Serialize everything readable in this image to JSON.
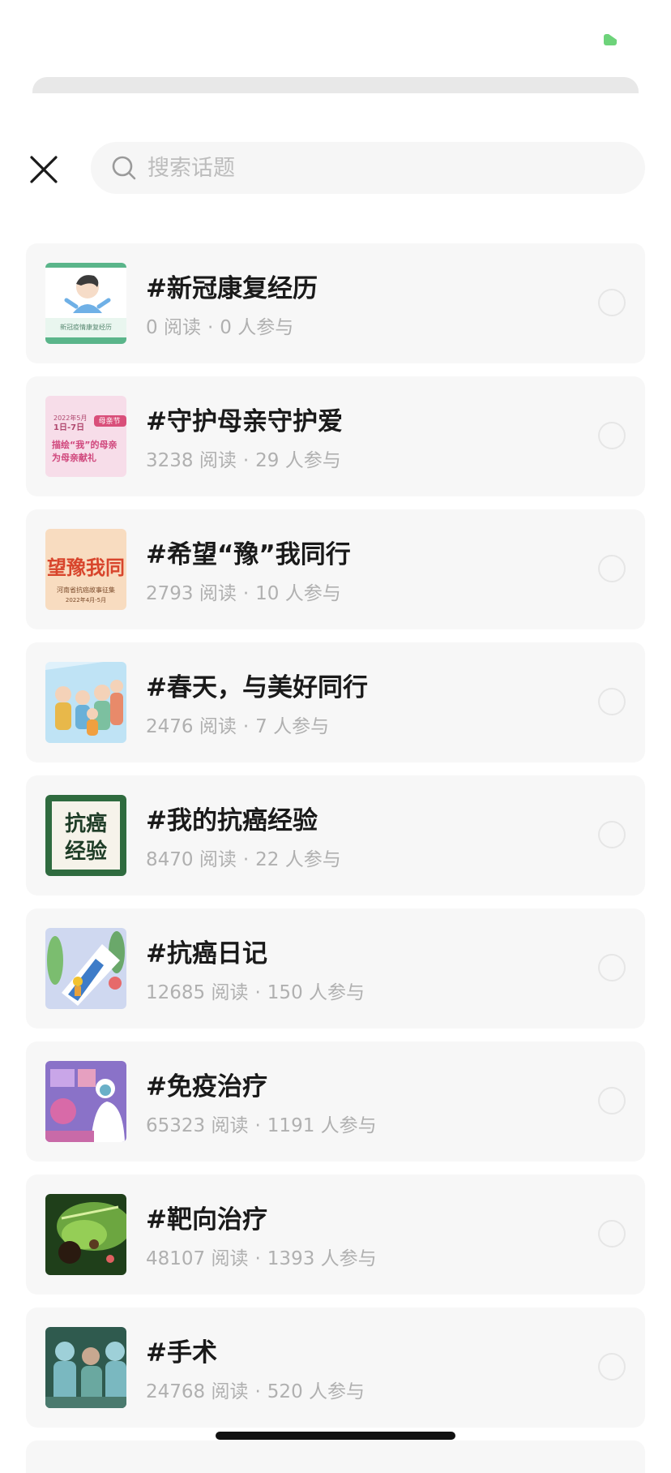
{
  "search": {
    "placeholder": "搜索话题"
  },
  "icons": {
    "close": "close-icon",
    "search": "search-icon",
    "status": "status-icon"
  },
  "colors": {
    "status_green": "#6dd37a",
    "card_bg": "#f7f7f7",
    "stats_gray": "#b0b0b0"
  },
  "topics": [
    {
      "title": "#新冠康复经历",
      "reads": "0 阅读",
      "participants": "0 人参与"
    },
    {
      "title": "#守护母亲守护爱",
      "reads": "3238 阅读",
      "participants": "29 人参与"
    },
    {
      "title": "#希望“豫”我同行",
      "reads": "2793 阅读",
      "participants": "10 人参与"
    },
    {
      "title": "#春天，与美好同行",
      "reads": "2476 阅读",
      "participants": "7 人参与"
    },
    {
      "title": "#我的抗癌经验",
      "reads": "8470 阅读",
      "participants": "22 人参与"
    },
    {
      "title": "#抗癌日记",
      "reads": "12685 阅读",
      "participants": "150 人参与"
    },
    {
      "title": "#免疫治疗",
      "reads": "65323 阅读",
      "participants": "1191 人参与"
    },
    {
      "title": "#靶向治疗",
      "reads": "48107 阅读",
      "participants": "1393 人参与"
    },
    {
      "title": "#手术",
      "reads": "24768 阅读",
      "participants": "520 人参与"
    }
  ],
  "thumbnails": {
    "t1": {
      "caption": "新冠疫情康复经历"
    },
    "t2": {
      "date": "2022年5月",
      "date2": "1日-7日",
      "tag": "母亲节",
      "line1": "描绘“我”的母亲",
      "line2": "为母亲献礼"
    },
    "t3": {
      "big": "望豫我同",
      "line1": "河南省抗癌故事征集",
      "line2": "2022年4月-5月"
    },
    "t5": {
      "line1": "抗癌",
      "line2": "经验"
    }
  },
  "separator": "·"
}
